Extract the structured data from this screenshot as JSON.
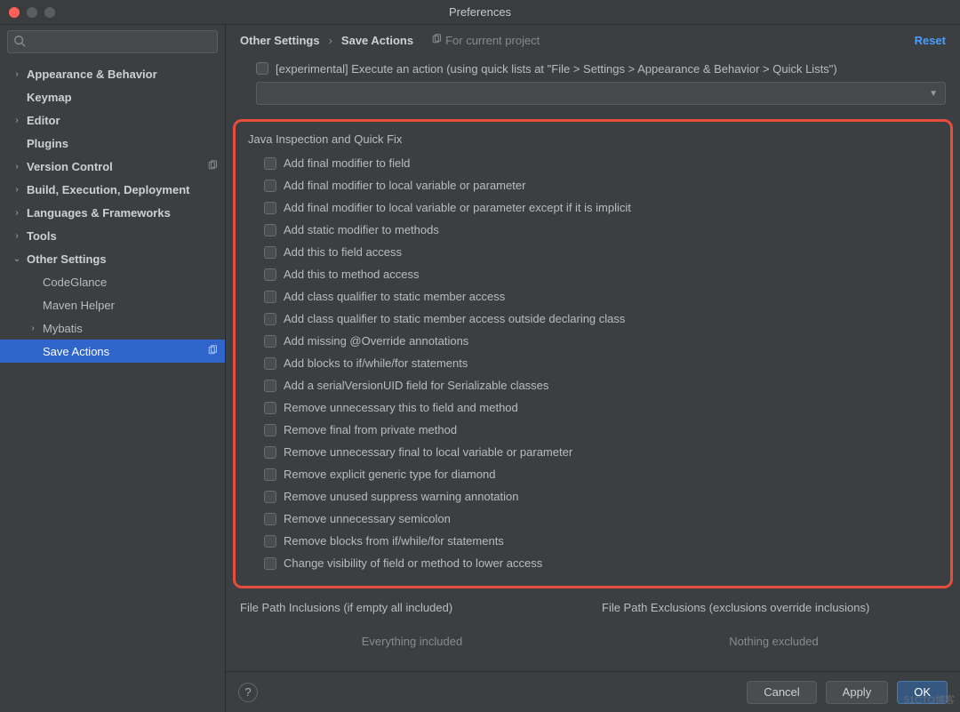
{
  "window_title": "Preferences",
  "search_placeholder": "",
  "sidebar": [
    {
      "label": "Appearance & Behavior",
      "bold": true,
      "chev": "right",
      "badge": false
    },
    {
      "label": "Keymap",
      "bold": true,
      "chev": "none",
      "badge": false
    },
    {
      "label": "Editor",
      "bold": true,
      "chev": "right",
      "badge": false
    },
    {
      "label": "Plugins",
      "bold": true,
      "chev": "none",
      "badge": false
    },
    {
      "label": "Version Control",
      "bold": true,
      "chev": "right",
      "badge": true
    },
    {
      "label": "Build, Execution, Deployment",
      "bold": true,
      "chev": "right",
      "badge": false
    },
    {
      "label": "Languages & Frameworks",
      "bold": true,
      "chev": "right",
      "badge": false
    },
    {
      "label": "Tools",
      "bold": true,
      "chev": "right",
      "badge": false
    },
    {
      "label": "Other Settings",
      "bold": true,
      "chev": "down",
      "badge": false
    },
    {
      "label": "CodeGlance",
      "bold": false,
      "chev": "child",
      "badge": false
    },
    {
      "label": "Maven Helper",
      "bold": false,
      "chev": "child",
      "badge": false
    },
    {
      "label": "Mybatis",
      "bold": false,
      "chev": "right-child",
      "badge": false
    },
    {
      "label": "Save Actions",
      "bold": false,
      "chev": "child",
      "badge": true,
      "selected": true
    }
  ],
  "breadcrumb": {
    "a": "Other Settings",
    "sep": "›",
    "b": "Save Actions"
  },
  "scope_label": "For current project",
  "reset_label": "Reset",
  "experimental_label": "[experimental] Execute an action (using quick lists at \"File > Settings > Appearance & Behavior > Quick Lists\")",
  "group_title": "Java Inspection and Quick Fix",
  "checks": [
    "Add final modifier to field",
    "Add final modifier to local variable or parameter",
    "Add final modifier to local variable or parameter except if it is implicit",
    "Add static modifier to methods",
    "Add this to field access",
    "Add this to method access",
    "Add class qualifier to static member access",
    "Add class qualifier to static member access outside declaring class",
    "Add missing @Override annotations",
    "Add blocks to if/while/for statements",
    "Add a serialVersionUID field for Serializable classes",
    "Remove unnecessary this to field and method",
    "Remove final from private method",
    "Remove unnecessary final to local variable or parameter",
    "Remove explicit generic type for diamond",
    "Remove unused suppress warning annotation",
    "Remove unnecessary semicolon",
    "Remove blocks from if/while/for statements",
    "Change visibility of field or method to lower access"
  ],
  "paths": {
    "incl_title": "File Path Inclusions (if empty all included)",
    "excl_title": "File Path Exclusions (exclusions override inclusions)",
    "incl_msg": "Everything included",
    "excl_msg": "Nothing excluded"
  },
  "footer": {
    "cancel": "Cancel",
    "apply": "Apply",
    "ok": "OK",
    "help": "?"
  },
  "watermark": "51CTO博客"
}
